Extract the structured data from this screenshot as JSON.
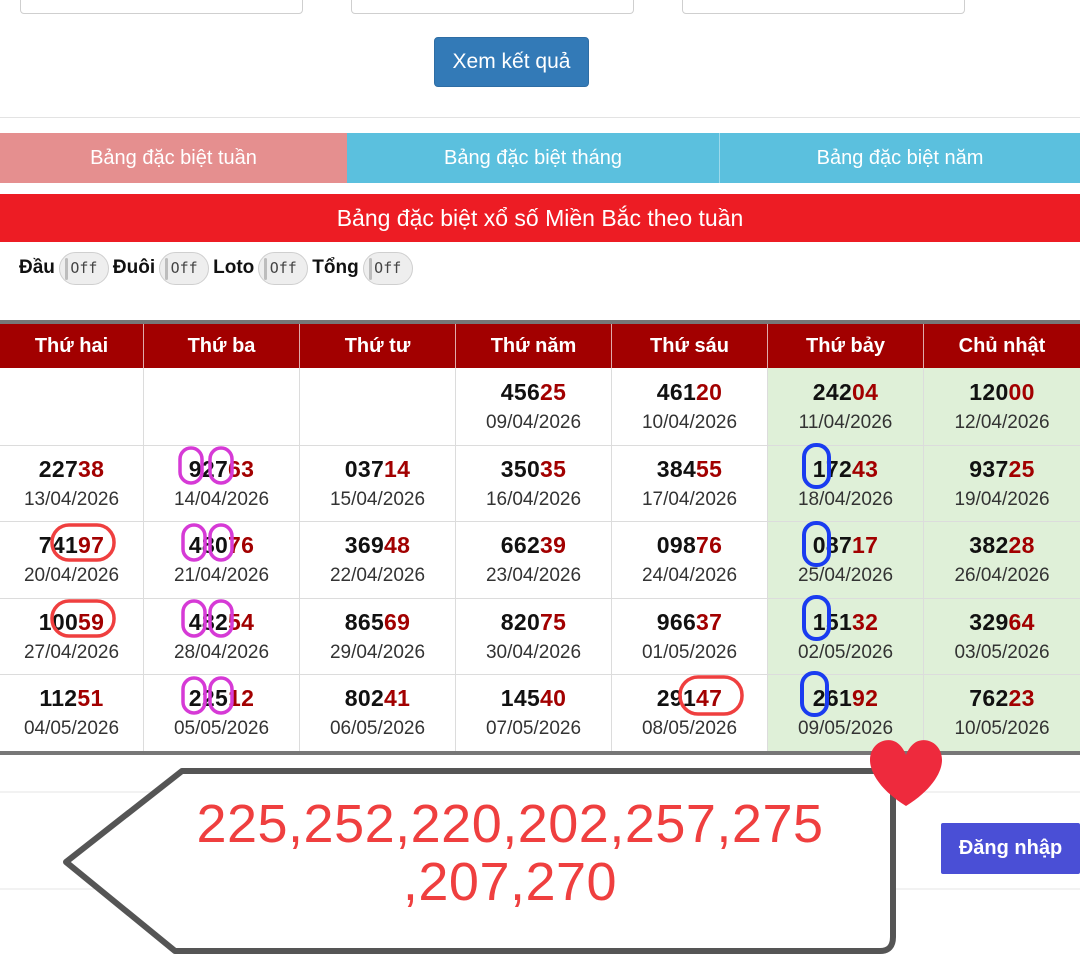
{
  "form": {
    "button_label": "Xem kết quả"
  },
  "tabs": [
    {
      "label": "Bảng đặc biệt tuần"
    },
    {
      "label": "Bảng đặc biệt tháng"
    },
    {
      "label": "Bảng đặc biệt năm"
    }
  ],
  "table_title": "Bảng đặc biệt xổ số Miền Bắc theo tuần",
  "toggles": [
    {
      "label": "Đầu",
      "state": "Off"
    },
    {
      "label": "Đuôi",
      "state": "Off"
    },
    {
      "label": "Loto",
      "state": "Off"
    },
    {
      "label": "Tổng",
      "state": "Off"
    }
  ],
  "columns": [
    "Thứ hai",
    "Thứ ba",
    "Thứ tư",
    "Thứ năm",
    "Thứ sáu",
    "Thứ bảy",
    "Chủ nhật"
  ],
  "rows": [
    [
      {
        "head": "",
        "tail": "",
        "date": ""
      },
      {
        "head": "",
        "tail": "",
        "date": ""
      },
      {
        "head": "",
        "tail": "",
        "date": ""
      },
      {
        "head": "456",
        "tail": "25",
        "date": "09/04/2026"
      },
      {
        "head": "461",
        "tail": "20",
        "date": "10/04/2026"
      },
      {
        "head": "242",
        "tail": "04",
        "date": "11/04/2026"
      },
      {
        "head": "120",
        "tail": "00",
        "date": "12/04/2026"
      }
    ],
    [
      {
        "head": "227",
        "tail": "38",
        "date": "13/04/2026"
      },
      {
        "head": "927",
        "tail": "63",
        "date": "14/04/2026"
      },
      {
        "head": "037",
        "tail": "14",
        "date": "15/04/2026"
      },
      {
        "head": "350",
        "tail": "35",
        "date": "16/04/2026"
      },
      {
        "head": "384",
        "tail": "55",
        "date": "17/04/2026"
      },
      {
        "head": "172",
        "tail": "43",
        "date": "18/04/2026"
      },
      {
        "head": "937",
        "tail": "25",
        "date": "19/04/2026"
      }
    ],
    [
      {
        "head": "741",
        "tail": "97",
        "date": "20/04/2026"
      },
      {
        "head": "480",
        "tail": "76",
        "date": "21/04/2026"
      },
      {
        "head": "369",
        "tail": "48",
        "date": "22/04/2026"
      },
      {
        "head": "662",
        "tail": "39",
        "date": "23/04/2026"
      },
      {
        "head": "098",
        "tail": "76",
        "date": "24/04/2026"
      },
      {
        "head": "087",
        "tail": "17",
        "date": "25/04/2026"
      },
      {
        "head": "382",
        "tail": "28",
        "date": "26/04/2026"
      }
    ],
    [
      {
        "head": "100",
        "tail": "59",
        "date": "27/04/2026"
      },
      {
        "head": "482",
        "tail": "54",
        "date": "28/04/2026"
      },
      {
        "head": "865",
        "tail": "69",
        "date": "29/04/2026"
      },
      {
        "head": "820",
        "tail": "75",
        "date": "30/04/2026"
      },
      {
        "head": "966",
        "tail": "37",
        "date": "01/05/2026"
      },
      {
        "head": "151",
        "tail": "32",
        "date": "02/05/2026"
      },
      {
        "head": "329",
        "tail": "64",
        "date": "03/05/2026"
      }
    ],
    [
      {
        "head": "112",
        "tail": "51",
        "date": "04/05/2026"
      },
      {
        "head": "225",
        "tail": "12",
        "date": "05/05/2026"
      },
      {
        "head": "802",
        "tail": "41",
        "date": "06/05/2026"
      },
      {
        "head": "145",
        "tail": "40",
        "date": "07/05/2026"
      },
      {
        "head": "291",
        "tail": "47",
        "date": "08/05/2026"
      },
      {
        "head": "261",
        "tail": "92",
        "date": "09/05/2026"
      },
      {
        "head": "762",
        "tail": "23",
        "date": "10/05/2026"
      }
    ]
  ],
  "annotation": {
    "line1": "225,252,220,202,257,275",
    "line2": ",207,270"
  },
  "login_button": "Đăng nhập",
  "colors": {
    "primary_button": "#337ab7",
    "tab_active": "#e58f8f",
    "tab_inactive": "#5bc0de",
    "title_bar": "#ed1c24",
    "table_header": "#a20000",
    "weekend_bg": "#dff0d8",
    "mark_red": "#ef3f3f",
    "mark_magenta": "#d63ad6",
    "mark_blue": "#1a3cf0",
    "login_button": "#4a4fd6"
  }
}
